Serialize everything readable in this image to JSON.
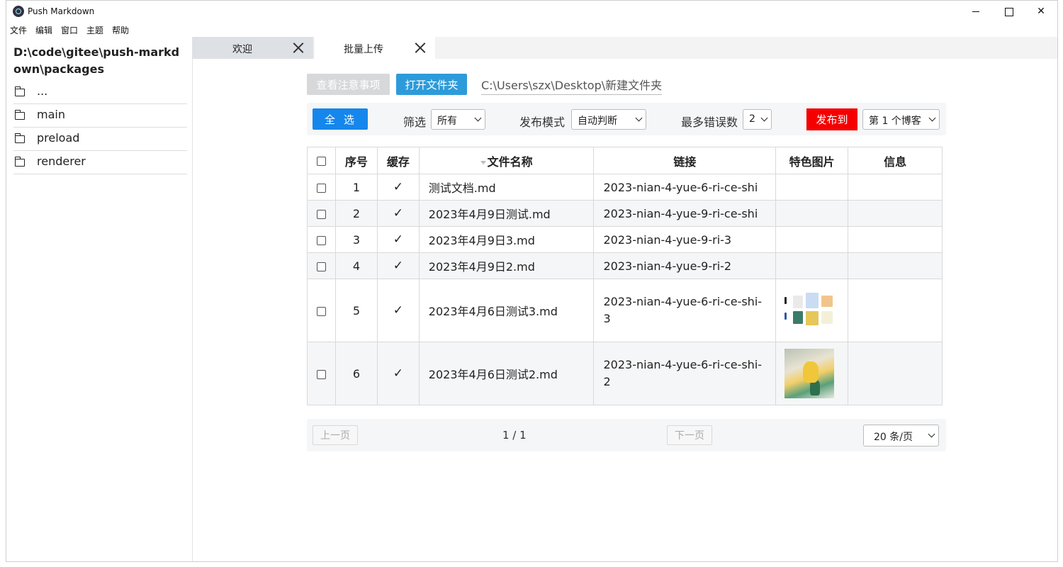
{
  "window": {
    "title": "Push Markdown"
  },
  "menu": [
    "文件",
    "编辑",
    "窗口",
    "主题",
    "帮助"
  ],
  "sidebar": {
    "path": "D:\\code\\gitee\\push-markdown\\packages",
    "items": [
      {
        "label": "...",
        "icon": "folder-open-icon"
      },
      {
        "label": "main",
        "icon": "folder-icon"
      },
      {
        "label": "preload",
        "icon": "folder-icon"
      },
      {
        "label": "renderer",
        "icon": "folder-icon"
      }
    ]
  },
  "tabs": [
    {
      "label": "欢迎",
      "active": false
    },
    {
      "label": "批量上传",
      "active": true
    }
  ],
  "actions": {
    "notice_label": "查看注意事项",
    "open_folder_label": "打开文件夹",
    "folder_path": "C:\\Users\\szx\\Desktop\\新建文件夹"
  },
  "toolbar": {
    "select_all_label": "全选",
    "filter_label": "筛选",
    "filter_value": "所有",
    "mode_label": "发布模式",
    "mode_value": "自动判断",
    "max_errors_label": "最多错误数",
    "max_errors_value": "2",
    "publish_label": "发布到",
    "blog_value": "第 1 个博客"
  },
  "table": {
    "headers": [
      "序号",
      "缓存",
      "文件名称",
      "链接",
      "特色图片",
      "信息"
    ],
    "rows": [
      {
        "index": "1",
        "cached": "✓",
        "name": "测试文档.md",
        "link": "2023-nian-4-yue-6-ri-ce-shi",
        "image": "",
        "info": ""
      },
      {
        "index": "2",
        "cached": "✓",
        "name": "2023年4月9日测试.md",
        "link": "2023-nian-4-yue-9-ri-ce-shi",
        "image": "",
        "info": ""
      },
      {
        "index": "3",
        "cached": "✓",
        "name": "2023年4月9日3.md",
        "link": "2023-nian-4-yue-9-ri-3",
        "image": "",
        "info": ""
      },
      {
        "index": "4",
        "cached": "✓",
        "name": "2023年4月9日2.md",
        "link": "2023-nian-4-yue-9-ri-2",
        "image": "",
        "info": ""
      },
      {
        "index": "5",
        "cached": "✓",
        "name": "2023年4月6日测试3.md",
        "link": "2023-nian-4-yue-6-ri-ce-shi-3",
        "image": "collage-thumbnail",
        "info": ""
      },
      {
        "index": "6",
        "cached": "✓",
        "name": "2023年4月6日测试2.md",
        "link": "2023-nian-4-yue-6-ri-ce-shi-2",
        "image": "illustration-thumbnail",
        "info": ""
      }
    ]
  },
  "pager": {
    "prev_label": "上一页",
    "page_info": "1 / 1",
    "next_label": "下一页",
    "page_size_value": "20 条/页"
  },
  "colors": {
    "open_button": "#2d9bda",
    "select_all_button": "#1586ec",
    "publish_button": "#f50000",
    "check": "#2e7d32"
  }
}
